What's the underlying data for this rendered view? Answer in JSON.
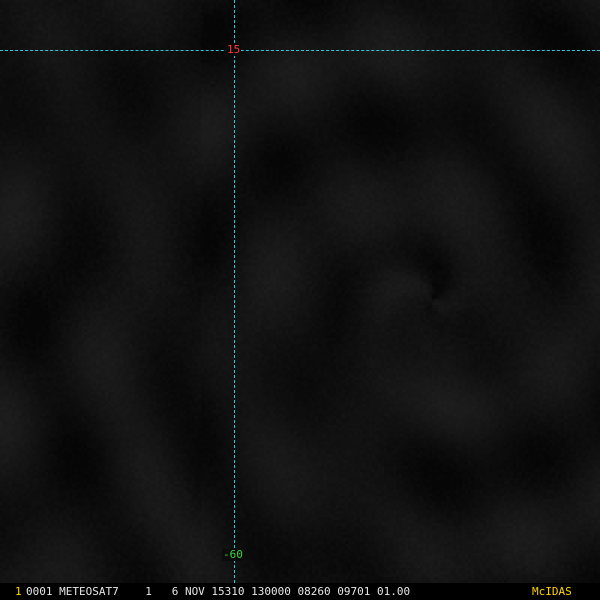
{
  "colors": {
    "grid_line": "#2fc9d6",
    "latitude_label": "#ff3b3b",
    "longitude_label": "#3bd63b",
    "frame_number": "#ffd200",
    "brand": "#ffd200",
    "status_text": "#e6e6e6"
  },
  "gridlines": {
    "latitude_label": "15",
    "longitude_label": "-60"
  },
  "status_bar": {
    "frame_number": "1",
    "info": "0001 METEOSAT7    1   6 NOV 15310 130000 08260 09701 01.00",
    "brand": "McIDAS"
  }
}
